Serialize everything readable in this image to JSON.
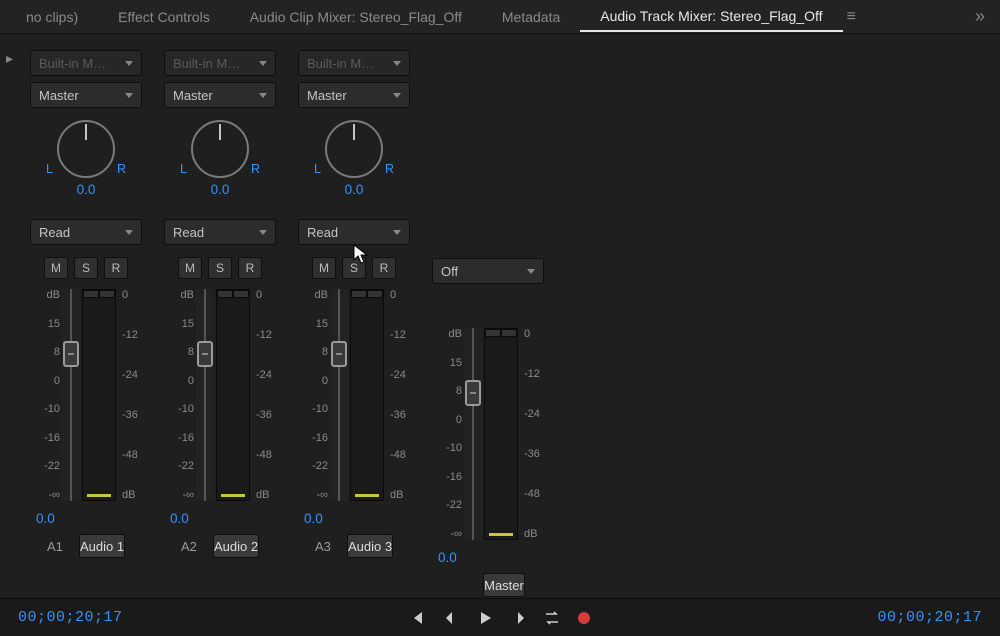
{
  "tabs": {
    "source": "no clips)",
    "effect_controls": "Effect Controls",
    "clip_mixer": "Audio Clip Mixer: Stereo_Flag_Off",
    "metadata": "Metadata",
    "track_mixer": "Audio Track Mixer: Stereo_Flag_Off"
  },
  "tracks": [
    {
      "input_select": "Built-in M…",
      "output_select": "Master",
      "pan_l": "L",
      "pan_r": "R",
      "pan_val": "0.0",
      "auto_mode": "Read",
      "btn_m": "M",
      "btn_s": "S",
      "btn_r": "R",
      "fader_val": "0.0",
      "id": "A1",
      "name": "Audio 1"
    },
    {
      "input_select": "Built-in M…",
      "output_select": "Master",
      "pan_l": "L",
      "pan_r": "R",
      "pan_val": "0.0",
      "auto_mode": "Read",
      "btn_m": "M",
      "btn_s": "S",
      "btn_r": "R",
      "fader_val": "0.0",
      "id": "A2",
      "name": "Audio 2"
    },
    {
      "input_select": "Built-in M…",
      "output_select": "Master",
      "pan_l": "L",
      "pan_r": "R",
      "pan_val": "0.0",
      "auto_mode": "Read",
      "btn_m": "M",
      "btn_s": "S",
      "btn_r": "R",
      "fader_val": "0.0",
      "id": "A3",
      "name": "Audio 3"
    }
  ],
  "master": {
    "auto_mode": "Off",
    "fader_val": "0.0",
    "name": "Master"
  },
  "fader_scale": {
    "db_label": "dB",
    "t15": "15",
    "t8": "8",
    "t0": "0",
    "tm10": "-10",
    "tm16": "-16",
    "tm22": "-22",
    "tminf": "-∞"
  },
  "meter_scale": {
    "t0": "0",
    "tm12": "-12",
    "tm24": "-24",
    "tm36": "-36",
    "tm48": "-48",
    "db_label": "dB"
  },
  "footer": {
    "timecode_left": "00;00;20;17",
    "timecode_right": "00;00;20;17"
  }
}
